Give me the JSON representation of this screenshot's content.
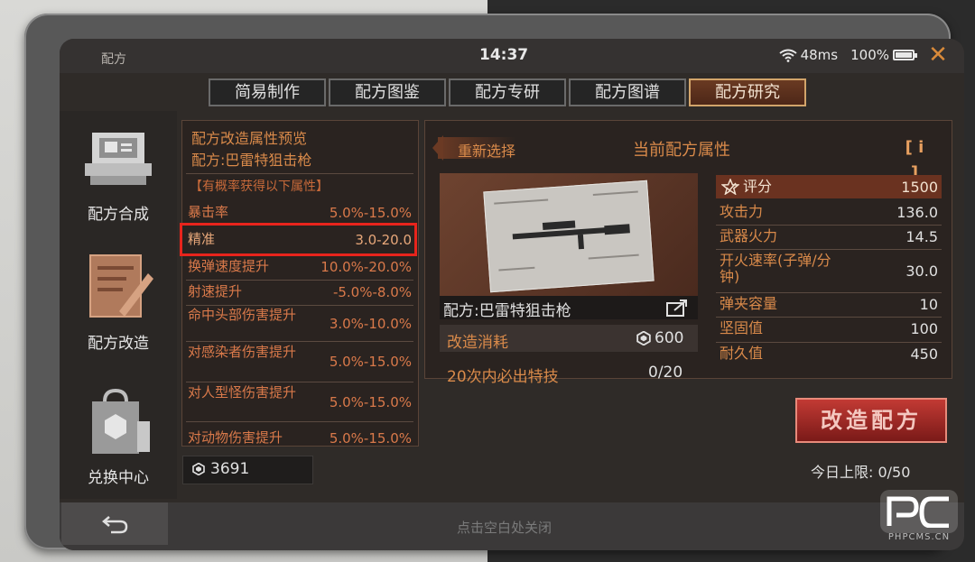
{
  "statusbar": {
    "app_title": "配方",
    "clock": "14:37",
    "ping": "48ms",
    "battery": "100%"
  },
  "tabs": [
    {
      "label": "简易制作",
      "active": false
    },
    {
      "label": "配方图鉴",
      "active": false
    },
    {
      "label": "配方专研",
      "active": false
    },
    {
      "label": "配方图谱",
      "active": false
    },
    {
      "label": "配方研究",
      "active": true
    }
  ],
  "sidebar": {
    "items": [
      {
        "label": "配方合成",
        "icon": "printer-icon"
      },
      {
        "label": "配方改造",
        "icon": "notepad-pen-icon"
      },
      {
        "label": "兑换中心",
        "icon": "shopping-bag-icon"
      }
    ]
  },
  "preview": {
    "title": "配方改造属性预览",
    "recipe": "配方:巴雷特狙击枪",
    "subtitle": "【有概率获得以下属性】",
    "attributes": [
      {
        "name": "暴击率",
        "value": "5.0%-15.0%"
      },
      {
        "name": "精准",
        "value": "3.0-20.0",
        "highlighted": true
      },
      {
        "name": "换弹速度提升",
        "value": "10.0%-20.0%"
      },
      {
        "name": "射速提升",
        "value": "-5.0%-8.0%"
      },
      {
        "name": "命中头部伤害提升",
        "value": "3.0%-10.0%"
      },
      {
        "name": "对感染者伤害提升",
        "value": "5.0%-15.0%"
      },
      {
        "name": "对人型怪伤害提升",
        "value": "5.0%-15.0%"
      },
      {
        "name": "对动物伤害提升",
        "value": "5.0%-15.0%"
      }
    ]
  },
  "currency": {
    "amount": "3691",
    "icon": "hexagon-coin-icon"
  },
  "current": {
    "reselect_label": "重新选择",
    "title": "当前配方属性",
    "info_label": "[ i ]",
    "image_caption": "配方:巴雷特狙击枪",
    "cost_label": "改造消耗",
    "cost_value": "600",
    "guarantee_label": "20次内必出特技",
    "guarantee_value": "0/20",
    "stats": [
      {
        "name": "评分",
        "value": "1500",
        "header": true
      },
      {
        "name": "攻击力",
        "value": "136.0"
      },
      {
        "name": "武器火力",
        "value": "14.5"
      },
      {
        "name": "开火速率(子弹/分钟)",
        "value": "30.0"
      },
      {
        "name": "弹夹容量",
        "value": "10"
      },
      {
        "name": "坚固值",
        "value": "100"
      },
      {
        "name": "耐久值",
        "value": "450"
      }
    ]
  },
  "modify_button": "改造配方",
  "daily_limit": "今日上限:  0/50",
  "close_hint": "点击空白处关闭",
  "watermark": "PHPCMS.CN",
  "colors": {
    "accent": "#d98a4a",
    "highlight_box": "#e8241c",
    "button": "#c23a34"
  }
}
